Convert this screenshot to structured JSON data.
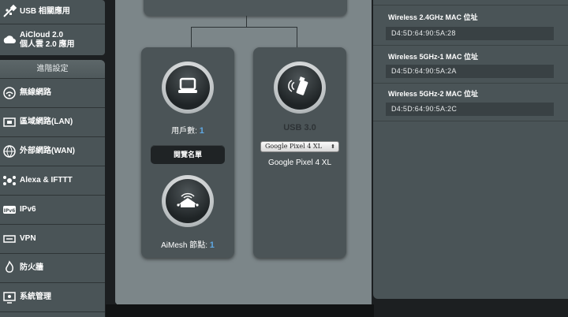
{
  "sidebar": {
    "top_items": [
      {
        "label": "USB 相關應用",
        "icon": "usb-app-icon"
      },
      {
        "label_line1": "AiCloud 2.0",
        "label_line2": "個人雲 2.0 應用",
        "icon": "cloud-icon"
      }
    ],
    "advanced_header": "進階設定",
    "items": [
      {
        "label": "無線網路",
        "icon": "wireless-icon"
      },
      {
        "label": "區域網路(LAN)",
        "icon": "lan-icon"
      },
      {
        "label": "外部網路(WAN)",
        "icon": "wan-icon"
      },
      {
        "label": "Alexa & IFTTT",
        "icon": "alexa-icon"
      },
      {
        "label": "IPv6",
        "icon": "ipv6-icon"
      },
      {
        "label": "VPN",
        "icon": "vpn-icon"
      },
      {
        "label": "防火牆",
        "icon": "firewall-icon"
      },
      {
        "label": "系統管理",
        "icon": "admin-icon"
      }
    ]
  },
  "clients_card": {
    "label": "用戶數:",
    "count": "1",
    "view_list_button": "閱覽名單",
    "aimesh_label": "AiMesh 節點:",
    "aimesh_count": "1"
  },
  "usb_card": {
    "title": "USB 3.0",
    "selected_device": "Google Pixel 4 XL",
    "device_name": "Google Pixel 4 XL"
  },
  "status_panel": {
    "rows": [
      {
        "title": "Wireless 2.4GHz MAC 位址",
        "value": "D4:5D:64:90:5A:28"
      },
      {
        "title": "Wireless 5GHz-1 MAC 位址",
        "value": "D4:5D:64:90:5A:2A"
      },
      {
        "title": "Wireless 5GHz-2 MAC 位址",
        "value": "D4:5D:64:90:5A:2C"
      }
    ]
  },
  "colors": {
    "accent_number": "#5fa8e3",
    "sidebar_bg": "#4a5457",
    "map_bg": "#7c8689"
  }
}
